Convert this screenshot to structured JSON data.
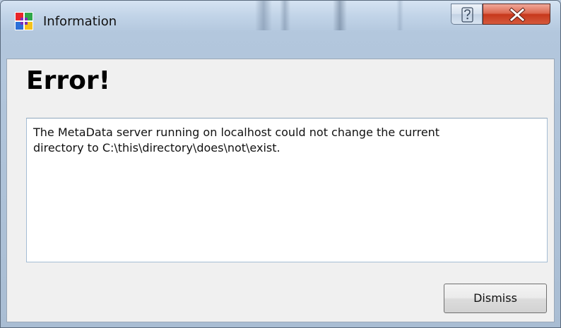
{
  "window": {
    "title": "Information",
    "app_icon": "app-logo-icon",
    "help_icon": "question-mark-icon",
    "close_icon": "close-x-icon"
  },
  "dialog": {
    "heading": "Error!",
    "message": "The MetaData server running on localhost could not change the current\ndirectory to C:\\this\\directory\\does\\not\\exist.",
    "dismiss_label": "Dismiss"
  },
  "colors": {
    "close_button": "#c7381c",
    "client_background": "#f0f0f0",
    "message_background": "#ffffff"
  }
}
